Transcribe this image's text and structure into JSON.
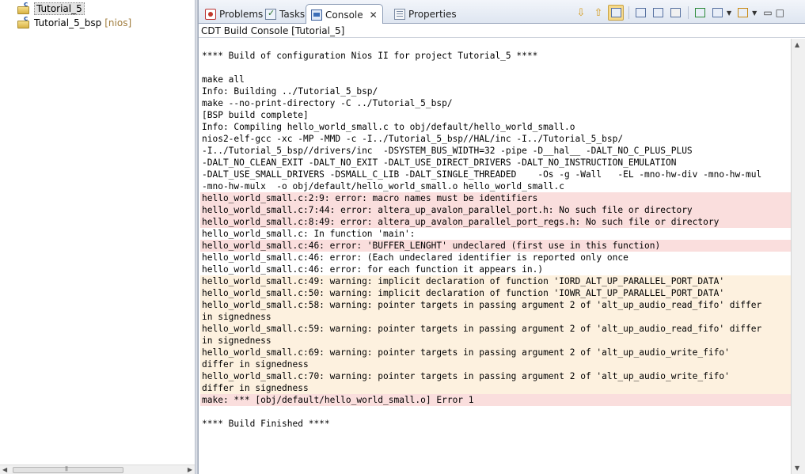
{
  "project_explorer": {
    "items": [
      {
        "label": "Tutorial_5",
        "suffix": "",
        "selected": true
      },
      {
        "label": "Tutorial_5_bsp",
        "suffix": "[nios]",
        "selected": false
      }
    ]
  },
  "tabs": [
    {
      "label": "Problems",
      "icon": "problems-icon",
      "active": false
    },
    {
      "label": "Tasks",
      "icon": "tasks-icon",
      "active": false
    },
    {
      "label": "Console",
      "icon": "console-icon",
      "active": true,
      "close": "✕"
    },
    {
      "label": "Properties",
      "icon": "properties-icon",
      "active": false
    }
  ],
  "console": {
    "title": "CDT Build Console [Tutorial_5]",
    "lines": [
      {
        "text": "**** Build of configuration Nios II for project Tutorial_5 ****",
        "type": "normal"
      },
      {
        "text": "",
        "type": "normal"
      },
      {
        "text": "make all",
        "type": "normal"
      },
      {
        "text": "Info: Building ../Tutorial_5_bsp/",
        "type": "normal"
      },
      {
        "text": "make --no-print-directory -C ../Tutorial_5_bsp/",
        "type": "normal"
      },
      {
        "text": "[BSP build complete]",
        "type": "normal"
      },
      {
        "text": "Info: Compiling hello_world_small.c to obj/default/hello_world_small.o",
        "type": "normal"
      },
      {
        "text": "nios2-elf-gcc -xc -MP -MMD -c -I../Tutorial_5_bsp//HAL/inc -I../Tutorial_5_bsp/",
        "type": "normal"
      },
      {
        "text": "-I../Tutorial_5_bsp//drivers/inc  -DSYSTEM_BUS_WIDTH=32 -pipe -D__hal__ -DALT_NO_C_PLUS_PLUS",
        "type": "normal"
      },
      {
        "text": "-DALT_NO_CLEAN_EXIT -DALT_NO_EXIT -DALT_USE_DIRECT_DRIVERS -DALT_NO_INSTRUCTION_EMULATION",
        "type": "normal"
      },
      {
        "text": "-DALT_USE_SMALL_DRIVERS -DSMALL_C_LIB -DALT_SINGLE_THREADED    -Os -g -Wall   -EL -mno-hw-div -mno-hw-mul",
        "type": "normal"
      },
      {
        "text": "-mno-hw-mulx  -o obj/default/hello_world_small.o hello_world_small.c",
        "type": "normal"
      },
      {
        "text": "hello_world_small.c:2:9: error: macro names must be identifiers",
        "type": "error"
      },
      {
        "text": "hello_world_small.c:7:44: error: altera_up_avalon_parallel_port.h: No such file or directory",
        "type": "error"
      },
      {
        "text": "hello_world_small.c:8:49: error: altera_up_avalon_parallel_port_regs.h: No such file or directory",
        "type": "error"
      },
      {
        "text": "hello_world_small.c: In function 'main':",
        "type": "normal"
      },
      {
        "text": "hello_world_small.c:46: error: 'BUFFER_LENGHT' undeclared (first use in this function)",
        "type": "error"
      },
      {
        "text": "hello_world_small.c:46: error: (Each undeclared identifier is reported only once",
        "type": "normal"
      },
      {
        "text": "hello_world_small.c:46: error: for each function it appears in.)",
        "type": "normal"
      },
      {
        "text": "hello_world_small.c:49: warning: implicit declaration of function 'IORD_ALT_UP_PARALLEL_PORT_DATA'",
        "type": "warning"
      },
      {
        "text": "hello_world_small.c:50: warning: implicit declaration of function 'IOWR_ALT_UP_PARALLEL_PORT_DATA'",
        "type": "warning"
      },
      {
        "text": "hello_world_small.c:58: warning: pointer targets in passing argument 2 of 'alt_up_audio_read_fifo' differ",
        "type": "warning"
      },
      {
        "text": "in signedness",
        "type": "warning"
      },
      {
        "text": "hello_world_small.c:59: warning: pointer targets in passing argument 2 of 'alt_up_audio_read_fifo' differ",
        "type": "warning"
      },
      {
        "text": "in signedness",
        "type": "warning"
      },
      {
        "text": "hello_world_small.c:69: warning: pointer targets in passing argument 2 of 'alt_up_audio_write_fifo'",
        "type": "warning"
      },
      {
        "text": "differ in signedness",
        "type": "warning"
      },
      {
        "text": "hello_world_small.c:70: warning: pointer targets in passing argument 2 of 'alt_up_audio_write_fifo'",
        "type": "warning"
      },
      {
        "text": "differ in signedness",
        "type": "warning"
      },
      {
        "text": "make: *** [obj/default/hello_world_small.o] Error 1",
        "type": "error"
      },
      {
        "text": "",
        "type": "normal"
      },
      {
        "text": "**** Build Finished ****",
        "type": "normal"
      }
    ]
  },
  "colors": {
    "error_bg": "#fadedd",
    "warning_bg": "#fdf1df",
    "tab_border": "#8b9bb5",
    "bsp_suffix": "#a07c3c"
  }
}
